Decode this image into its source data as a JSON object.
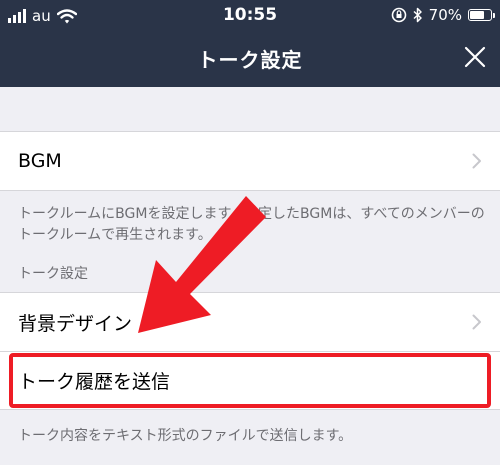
{
  "status_bar": {
    "carrier": "au",
    "time": "10:55",
    "battery": "70%",
    "battery_level": 0.7
  },
  "nav": {
    "title": "トーク設定"
  },
  "rows": {
    "bgm": "BGM",
    "bgm_description": "トークルームにBGMを設定します。設定したBGMは、すべてのメンバーのトークルームで再生されます。",
    "section_header": "トーク設定",
    "background": "背景デザイン",
    "export": "トーク履歴を送信",
    "export_description": "トーク内容をテキスト形式のファイルで送信します。"
  },
  "colors": {
    "nav_bg": "#2a3448",
    "highlight": "#ee1c25"
  }
}
